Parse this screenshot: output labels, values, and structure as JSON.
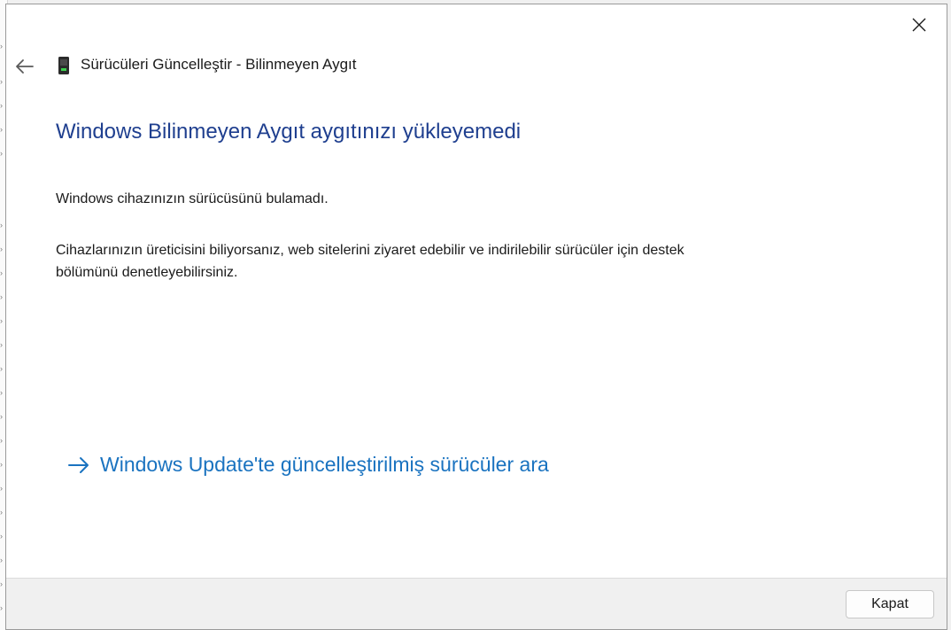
{
  "window": {
    "close_icon": "close-icon"
  },
  "wizard": {
    "back_icon": "back-arrow-icon",
    "device_icon": "usb-device-icon",
    "title": "Sürücüleri Güncelleştir - Bilinmeyen Aygıt"
  },
  "content": {
    "heading": "Windows Bilinmeyen Aygıt aygıtınızı yükleyemedi",
    "message_1": "Windows cihazınızın sürücüsünü bulamadı.",
    "message_2": "Cihazlarınızın üreticisini biliyorsanız, web sitelerini ziyaret edebilir ve indirilebilir sürücüler için destek bölümünü denetleyebilirsiniz.",
    "link_icon": "arrow-right-icon",
    "link_text": "Windows Update'te güncelleştirilmiş sürücüler ara"
  },
  "footer": {
    "close_label": "Kapat"
  },
  "colors": {
    "heading": "#1f3f8f",
    "link": "#1a73c0",
    "footer_bg": "#f0f0f0"
  }
}
